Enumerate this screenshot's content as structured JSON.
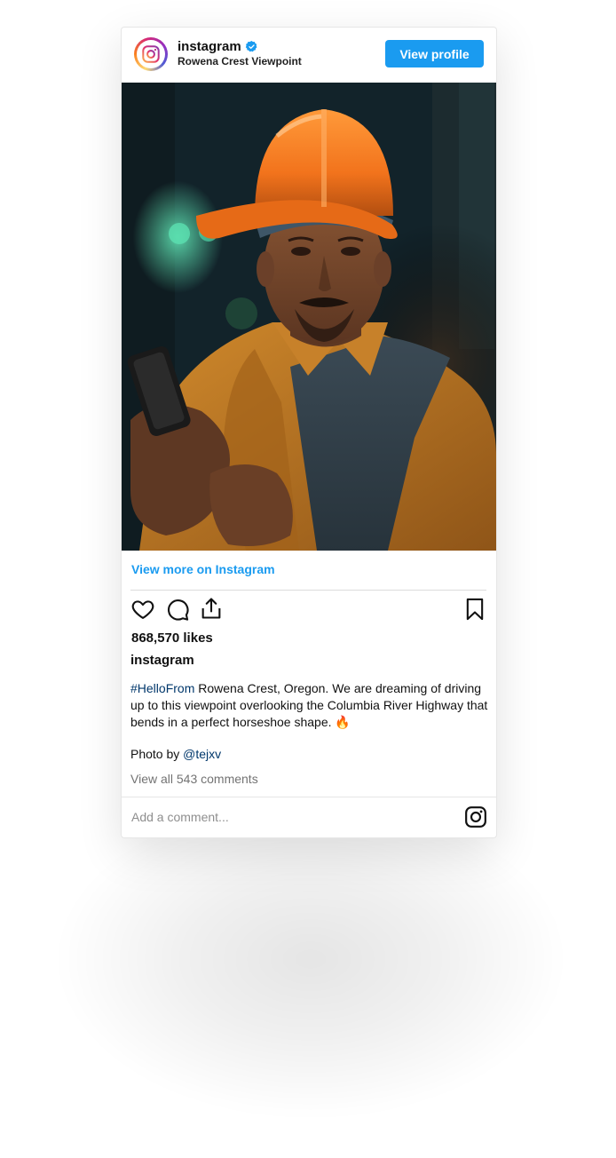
{
  "header": {
    "account_name": "instagram",
    "location": "Rowena Crest Viewpoint",
    "view_profile_label": "View profile"
  },
  "post": {
    "view_more_label": "View more on Instagram",
    "likes_text": "868,570 likes",
    "caption_user": "instagram",
    "caption_hashtag": "#HelloFrom",
    "caption_text": " Rowena Crest, Oregon. We are dreaming of driving up to this viewpoint overlooking the Columbia River Highway that bends in a perfect horseshoe shape. 🔥",
    "credit_prefix": "Photo by ",
    "credit_handle": "@tejxv",
    "view_comments_label": "View all 543 comments"
  },
  "comment": {
    "placeholder": "Add a comment..."
  },
  "colors": {
    "accent": "#1a9bf0",
    "link_dark": "#00376b",
    "muted": "#737373"
  },
  "icons": [
    "instagram-logo-icon",
    "verified-badge-icon",
    "heart-icon",
    "comment-icon",
    "share-icon",
    "bookmark-icon",
    "instagram-icon"
  ]
}
